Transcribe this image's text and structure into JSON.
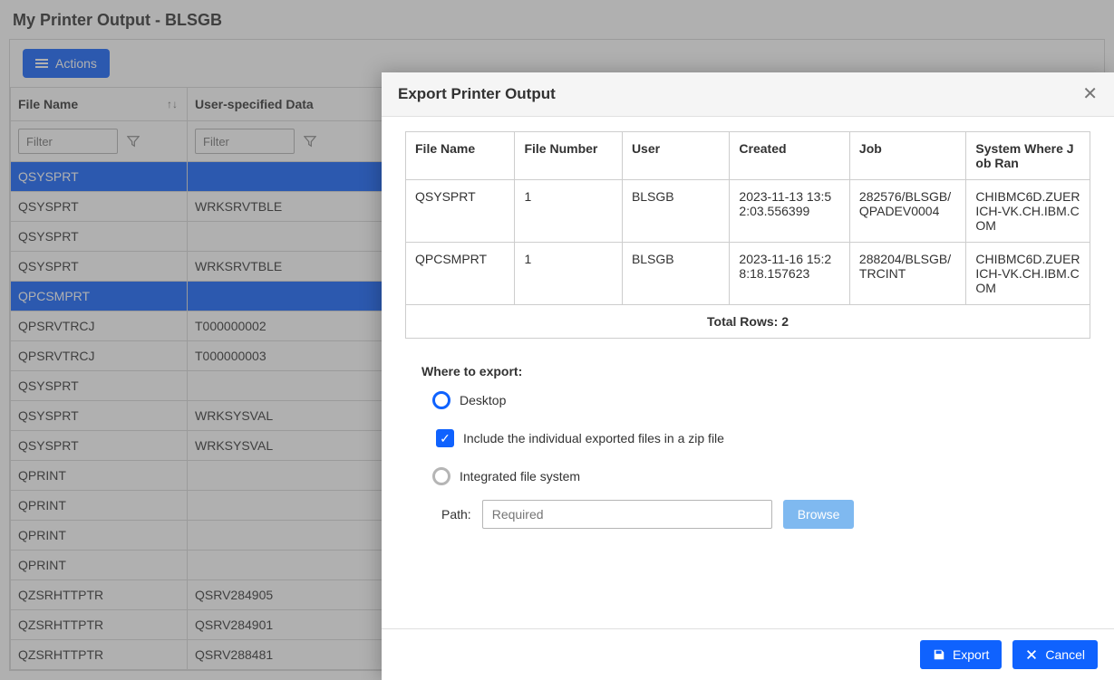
{
  "page_title": "My Printer Output - BLSGB",
  "actions_button": "Actions",
  "grid": {
    "columns": [
      "File Name",
      "User-specified Data"
    ],
    "filter_placeholder": "Filter",
    "rows": [
      {
        "file": "QSYSPRT",
        "data": "",
        "selected": true
      },
      {
        "file": "QSYSPRT",
        "data": "WRKSRVTBLE",
        "selected": false
      },
      {
        "file": "QSYSPRT",
        "data": "",
        "selected": false
      },
      {
        "file": "QSYSPRT",
        "data": "WRKSRVTBLE",
        "selected": false
      },
      {
        "file": "QPCSMPRT",
        "data": "",
        "selected": true
      },
      {
        "file": "QPSRVTRCJ",
        "data": "T000000002",
        "selected": false
      },
      {
        "file": "QPSRVTRCJ",
        "data": "T000000003",
        "selected": false
      },
      {
        "file": "QSYSPRT",
        "data": "",
        "selected": false
      },
      {
        "file": "QSYSPRT",
        "data": "WRKSYSVAL",
        "selected": false
      },
      {
        "file": "QSYSPRT",
        "data": "WRKSYSVAL",
        "selected": false
      },
      {
        "file": "QPRINT",
        "data": "",
        "selected": false
      },
      {
        "file": "QPRINT",
        "data": "",
        "selected": false
      },
      {
        "file": "QPRINT",
        "data": "",
        "selected": false
      },
      {
        "file": "QPRINT",
        "data": "",
        "selected": false
      },
      {
        "file": "QZSRHTTPTR",
        "data": "QSRV284905",
        "selected": false
      },
      {
        "file": "QZSRHTTPTR",
        "data": "QSRV284901",
        "selected": false
      },
      {
        "file": "QZSRHTTPTR",
        "data": "QSRV288481",
        "selected": false
      }
    ]
  },
  "modal": {
    "title": "Export Printer Output",
    "columns": [
      "File Name",
      "File Number",
      "User",
      "Created",
      "Job",
      "System Where Job Ran"
    ],
    "rows": [
      {
        "file": "QSYSPRT",
        "number": "1",
        "user": "BLSGB",
        "created": "2023-11-13 13:52:03.556399",
        "job": "282576/BLSGB/QPADEV0004",
        "system": "CHIBMC6D.ZUERICH-VK.CH.IBM.COM"
      },
      {
        "file": "QPCSMPRT",
        "number": "1",
        "user": "BLSGB",
        "created": "2023-11-16 15:28:18.157623",
        "job": "288204/BLSGB/TRCINT",
        "system": "CHIBMC6D.ZUERICH-VK.CH.IBM.COM"
      }
    ],
    "total_rows_label": "Total Rows: 2",
    "where_label": "Where to export:",
    "opt_desktop": "Desktop",
    "opt_zip": "Include the individual exported files in a zip file",
    "opt_ifs": "Integrated file system",
    "path_label": "Path:",
    "path_placeholder": "Required",
    "browse": "Browse",
    "export": "Export",
    "cancel": "Cancel"
  }
}
